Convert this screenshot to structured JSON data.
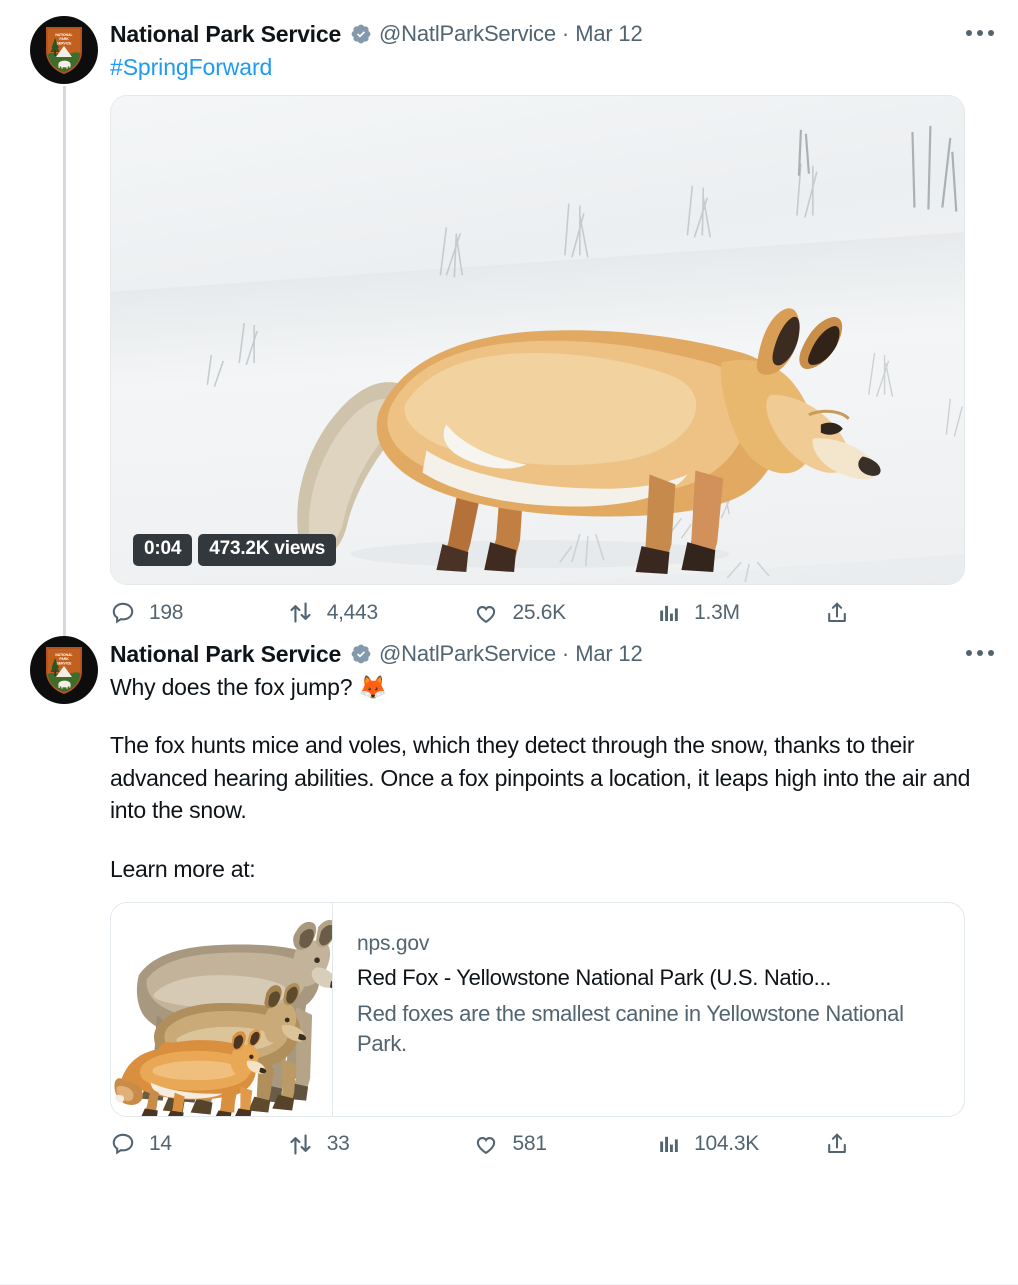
{
  "thread": {
    "tweets": [
      {
        "author": {
          "display_name": "National Park Service",
          "handle": "@NatlParkService",
          "verified": true,
          "avatar_icon": "nps-arrowhead-logo"
        },
        "separator": "·",
        "date": "Mar 12",
        "more_icon": "more-options-icon",
        "text_hashtag": "#SpringForward",
        "media": {
          "type": "video",
          "alt": "A red fox walking across a snow-covered field",
          "duration": "0:04",
          "views_label": "473.2K views"
        },
        "actions": [
          {
            "icon": "reply-icon",
            "name": "reply",
            "count": "198"
          },
          {
            "icon": "retweet-icon",
            "name": "retweet",
            "count": "4,443"
          },
          {
            "icon": "like-icon",
            "name": "like",
            "count": "25.6K"
          },
          {
            "icon": "analytics-icon",
            "name": "views",
            "count": "1.3M"
          },
          {
            "icon": "share-icon",
            "name": "share",
            "count": ""
          }
        ]
      },
      {
        "author": {
          "display_name": "National Park Service",
          "handle": "@NatlParkService",
          "verified": true,
          "avatar_icon": "nps-arrowhead-logo"
        },
        "separator": "·",
        "date": "Mar 12",
        "more_icon": "more-options-icon",
        "line_1": "Why does the fox jump? 🦊",
        "paragraph": "The fox hunts mice and voles, which they detect through the snow, thanks to their advanced hearing abilities. Once a fox pinpoints a location, it leaps high into the air and into the snow.",
        "learn_more": "Learn more at:",
        "card": {
          "domain": "nps.gov",
          "title": "Red Fox - Yellowstone National Park (U.S. Natio...",
          "description": "Red foxes are the smallest canine in Yellowstone National Park.",
          "thumb_alt": "Illustration comparing the sizes of a wolf, a coyote and a red fox"
        },
        "actions": [
          {
            "icon": "reply-icon",
            "name": "reply",
            "count": "14"
          },
          {
            "icon": "retweet-icon",
            "name": "retweet",
            "count": "33"
          },
          {
            "icon": "like-icon",
            "name": "like",
            "count": "581"
          },
          {
            "icon": "analytics-icon",
            "name": "views",
            "count": "104.3K"
          },
          {
            "icon": "share-icon",
            "name": "share",
            "count": ""
          }
        ]
      }
    ]
  },
  "colors": {
    "link_blue": "#1d9bf0",
    "text_primary": "#0f1419",
    "text_secondary": "#536471",
    "verified_gray": "#829aab",
    "border": "#e1e8ed",
    "badge_bg": "#33383c"
  }
}
